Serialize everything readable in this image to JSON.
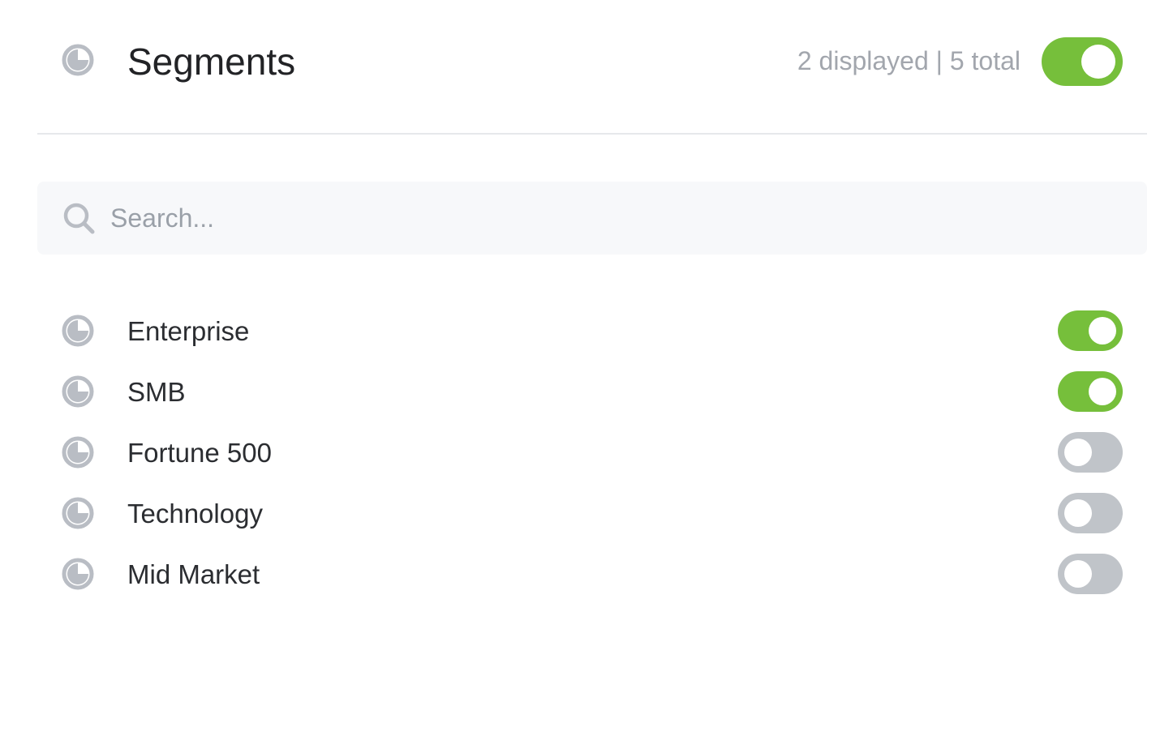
{
  "header": {
    "title": "Segments",
    "count_text": "2 displayed | 5 total",
    "master_toggle_on": true
  },
  "search": {
    "placeholder": "Search...",
    "value": ""
  },
  "segments": [
    {
      "label": "Enterprise",
      "enabled": true
    },
    {
      "label": "SMB",
      "enabled": true
    },
    {
      "label": "Fortune 500",
      "enabled": false
    },
    {
      "label": "Technology",
      "enabled": false
    },
    {
      "label": "Mid Market",
      "enabled": false
    }
  ],
  "colors": {
    "toggle_on": "#76bf3b",
    "toggle_off": "#c0c4c9",
    "icon": "#b9bdc4"
  },
  "icons": {
    "segment": "segment-pie-icon",
    "search": "search-icon"
  }
}
